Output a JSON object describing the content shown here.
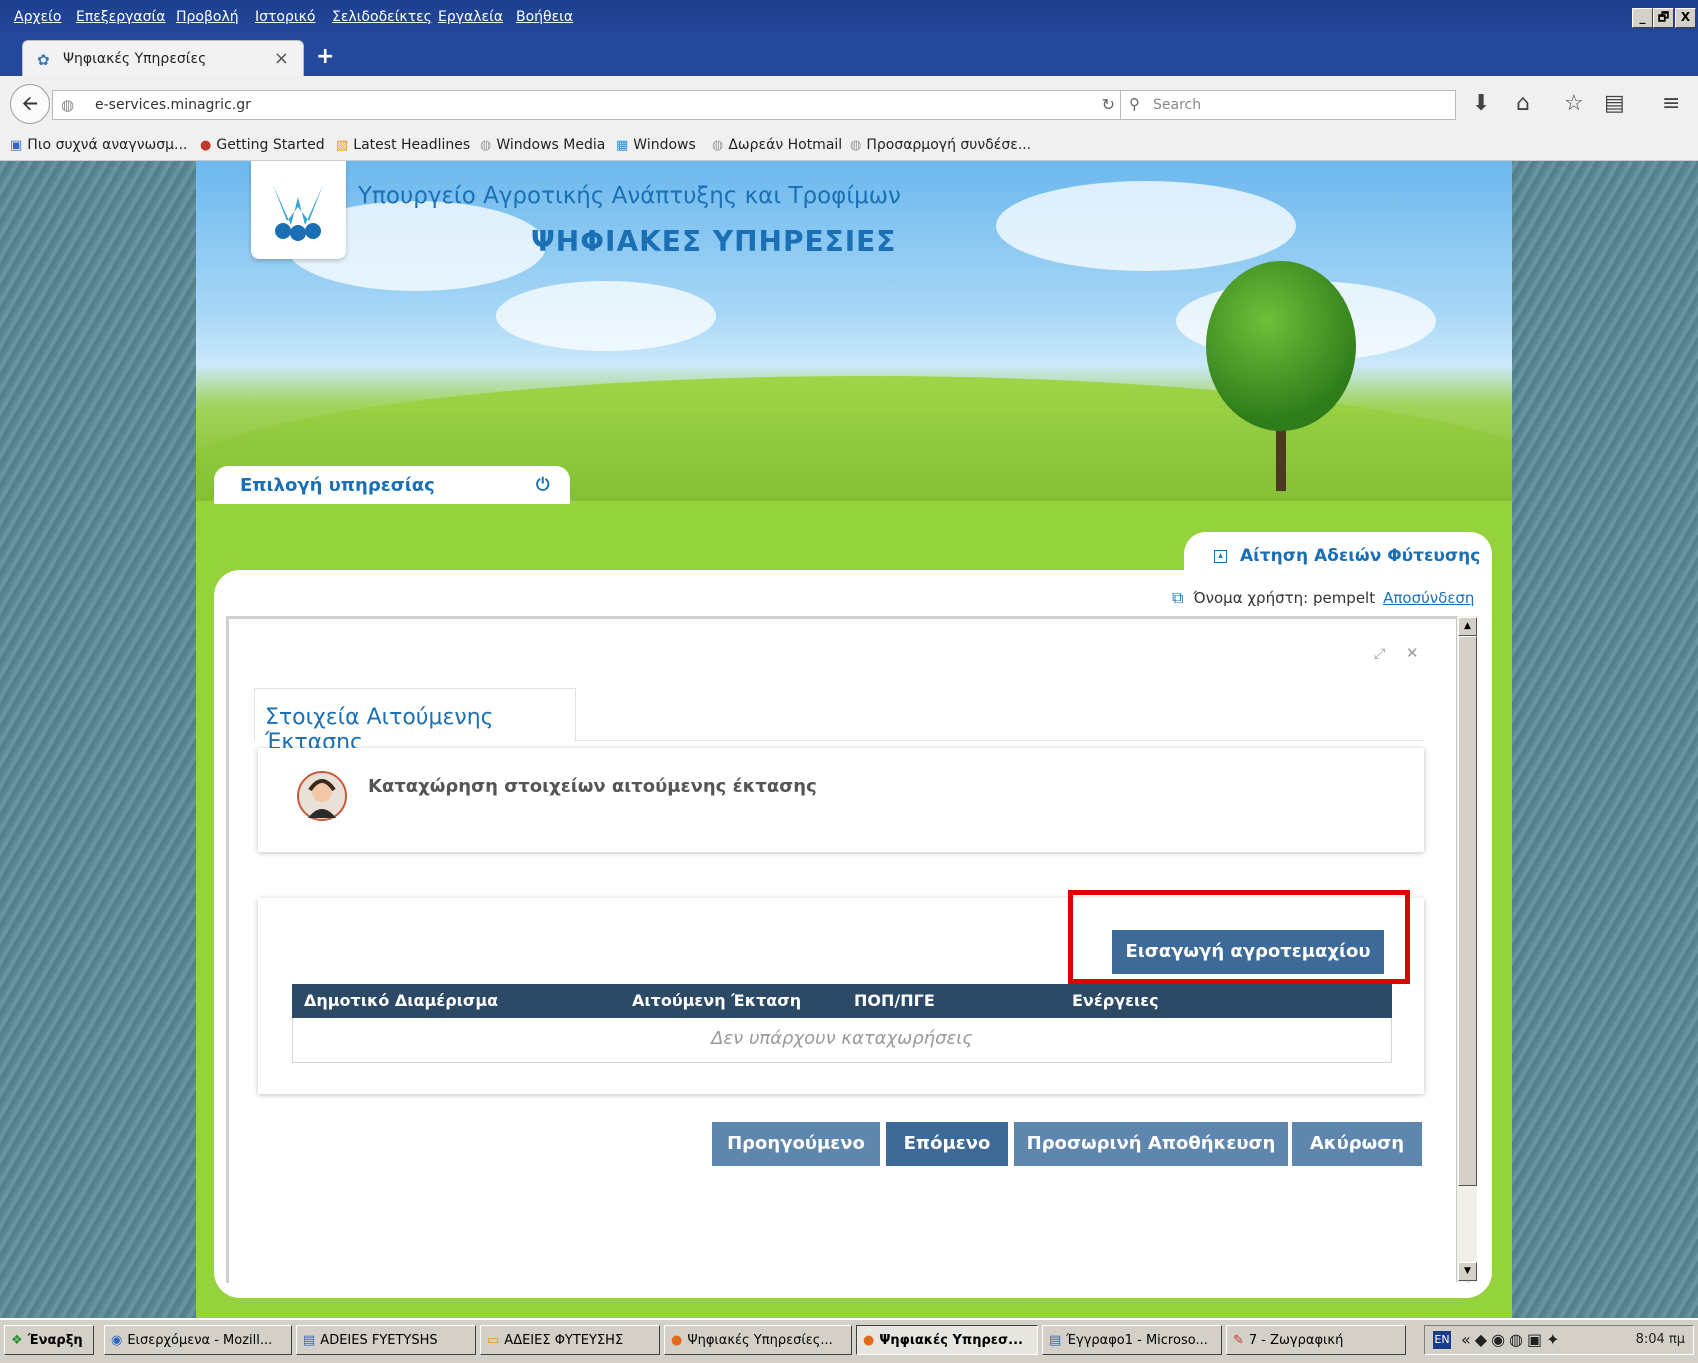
{
  "browser": {
    "menu": [
      "Αρχείο",
      "Επεξεργασία",
      "Προβολή",
      "Ιστορικό",
      "Σελιδοδείκτες",
      "Εργαλεία",
      "Βοήθεια"
    ],
    "window_controls": [
      "_",
      "🗗",
      "X"
    ],
    "tab_title": "Ψηφιακές Υπηρεσίες",
    "new_tab": "+",
    "url": "e-services.minagric.gr",
    "search_placeholder": "Search",
    "bookmarks": [
      {
        "label": "Πιο συχνά αναγνωσμ...",
        "icon": "frequent-icon"
      },
      {
        "label": "Getting Started",
        "icon": "firefox-icon"
      },
      {
        "label": "Latest Headlines",
        "icon": "rss-icon"
      },
      {
        "label": "Windows Media",
        "icon": "globe-icon"
      },
      {
        "label": "Windows",
        "icon": "windows-icon"
      },
      {
        "label": "Δωρεάν Hotmail",
        "icon": "globe-icon"
      },
      {
        "label": "Προσαρμογή συνδέσε...",
        "icon": "globe-icon"
      }
    ]
  },
  "site": {
    "ministry": "Υπουργείο Αγροτικής Ανάπτυξης και Τροφίμων",
    "title": "ΨΗΦΙΑΚΕΣ ΥΠΗΡΕΣΙΕΣ",
    "service_select": "Επιλογή υπηρεσίας",
    "application_tab": "Αίτηση Αδειών Φύτευσης",
    "user_label": "Όνομα χρήστη: pempelt",
    "logout": "Αποσύνδεση",
    "section_tab": "Στοιχεία Αιτούμενης Έκτασης",
    "info_text": "Καταχώρηση στοιχείων αιτούμενης έκτασης",
    "add_parcel": "Εισαγωγή αγροτεμαχίου",
    "table": {
      "columns": [
        "Δημοτικό Διαμέρισμα",
        "Αιτούμενη Έκταση",
        "ΠΟΠ/ΠΓΕ",
        "Ενέργειες"
      ],
      "empty": "Δεν υπάρχουν καταχωρήσεις"
    },
    "buttons": {
      "prev": "Προηγούμενο",
      "next": "Επόμενο",
      "save": "Προσωρινή Αποθήκευση",
      "cancel": "Ακύρωση"
    }
  },
  "taskbar": {
    "start": "Έναρξη",
    "items": [
      "Εισερχόμενα - Mozill...",
      "ADEIES FYETYSHS",
      "ΑΔΕΙΕΣ ΦΥΤΕΥΣΗΣ",
      "Ψηφιακές Υπηρεσίες...",
      "Ψηφιακές Υπηρεσ...",
      "Έγγραφο1 - Microso...",
      "7 - Ζωγραφική"
    ],
    "lang": "EN",
    "clock": "8:04 πμ"
  },
  "colors": {
    "xp_blue": "#23489c",
    "site_green": "#95d33c",
    "brand_blue": "#1b6fb5",
    "button_blue": "#3d6a96",
    "table_header": "#2c4965",
    "highlight_red": "#e00000"
  }
}
